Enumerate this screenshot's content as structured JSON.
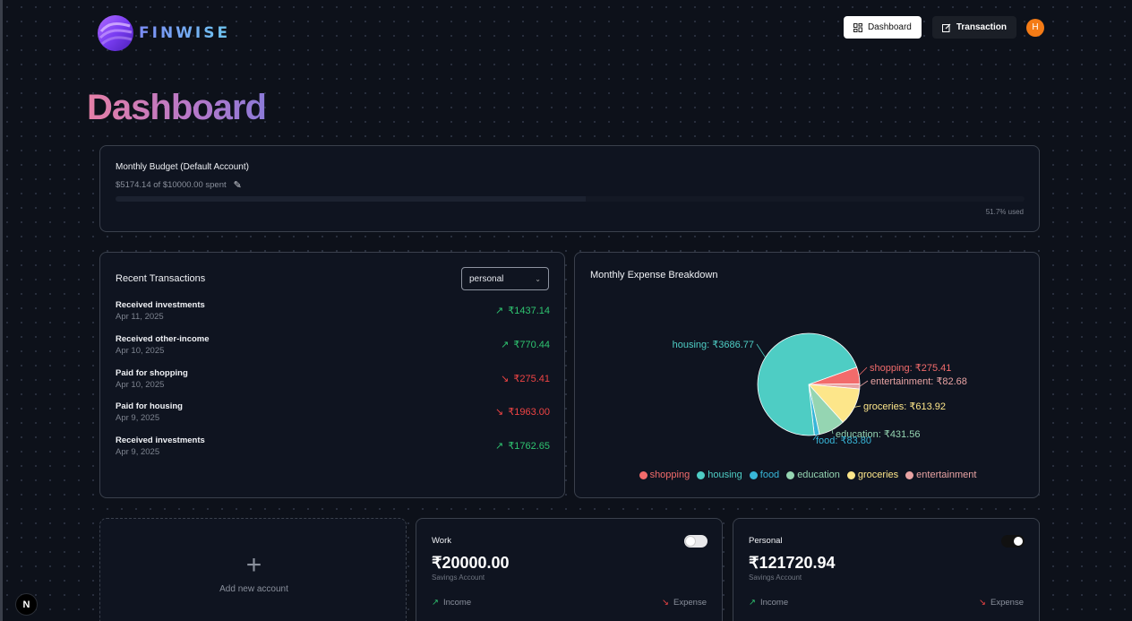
{
  "app": {
    "name": "FINWISE"
  },
  "nav": {
    "dashboard_label": "Dashboard",
    "transaction_label": "Transaction",
    "avatar_initial": "H"
  },
  "page": {
    "title": "Dashboard"
  },
  "budget": {
    "title": "Monthly Budget (Default Account)",
    "spent_text": "$5174.14 of $10000.00 spent",
    "used_text": "51.7% used",
    "used_fraction": 0.517
  },
  "transactions": {
    "title": "Recent Transactions",
    "account_filter": "personal",
    "items": [
      {
        "name": "Received investments",
        "date": "Apr 11, 2025",
        "amount": "₹1437.14",
        "type": "income"
      },
      {
        "name": "Received other-income",
        "date": "Apr 10, 2025",
        "amount": "₹770.44",
        "type": "income"
      },
      {
        "name": "Paid for shopping",
        "date": "Apr 10, 2025",
        "amount": "₹275.41",
        "type": "expense"
      },
      {
        "name": "Paid for housing",
        "date": "Apr 9, 2025",
        "amount": "₹1963.00",
        "type": "expense"
      },
      {
        "name": "Received investments",
        "date": "Apr 9, 2025",
        "amount": "₹1762.65",
        "type": "income"
      }
    ]
  },
  "expense_chart": {
    "title": "Monthly Expense Breakdown"
  },
  "chart_data": {
    "type": "pie",
    "title": "Monthly Expense Breakdown",
    "slices": [
      {
        "name": "shopping",
        "value": 275.41,
        "label": "shopping: ₹275.41",
        "color": "#f26b6b"
      },
      {
        "name": "entertainment",
        "value": 82.68,
        "label": "entertainment: ₹82.68",
        "color": "#e8a3a3"
      },
      {
        "name": "groceries",
        "value": 613.92,
        "label": "groceries: ₹613.92",
        "color": "#fde68a"
      },
      {
        "name": "education",
        "value": 431.56,
        "label": "education: ₹431.56",
        "color": "#95d5b2"
      },
      {
        "name": "food",
        "value": 83.8,
        "label": "food: ₹83.80",
        "color": "#38b6d8"
      },
      {
        "name": "housing",
        "value": 3686.77,
        "label": "housing: ₹3686.77",
        "color": "#4ecdc4"
      }
    ],
    "legend": [
      "shopping",
      "housing",
      "food",
      "education",
      "groceries",
      "entertainment"
    ],
    "legend_placement": "bottom"
  },
  "accounts": {
    "add_label": "Add new account",
    "items": [
      {
        "name": "Work",
        "balance": "₹20000.00",
        "type": "Savings Account",
        "income_label": "Income",
        "expense_label": "Expense",
        "default": false
      },
      {
        "name": "Personal",
        "balance": "₹121720.94",
        "type": "Savings Account",
        "income_label": "Income",
        "expense_label": "Expense",
        "default": true
      }
    ]
  },
  "dev_badge": "N"
}
